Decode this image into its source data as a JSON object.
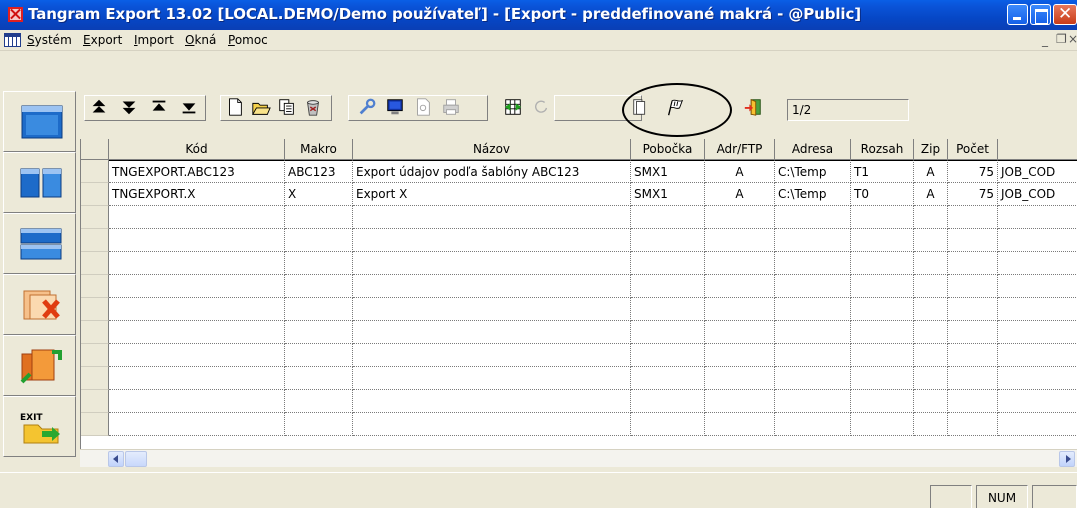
{
  "window": {
    "title": "Tangram Export 13.02 [LOCAL.DEMO/Demo používateľ] - [Export - preddefinované makrá - @Public]",
    "close_glyph": "✕"
  },
  "menu": {
    "items": [
      {
        "prefix": "",
        "underline": "S",
        "rest": "ystém"
      },
      {
        "prefix": "",
        "underline": "E",
        "rest": "xport"
      },
      {
        "prefix": "",
        "underline": "I",
        "rest": "mport"
      },
      {
        "prefix": "",
        "underline": "O",
        "rest": "kná"
      },
      {
        "prefix": "",
        "underline": "P",
        "rest": "omoc"
      }
    ],
    "mdi_min": "_",
    "mdi_restore": "❐",
    "mdi_close": "×"
  },
  "toolbar": {
    "page_indicator": "1/2"
  },
  "grid": {
    "columns": [
      "Kód",
      "Makro",
      "Názov",
      "Pobočka",
      "Adr/FTP",
      "Adresa",
      "Rozsah",
      "Zip",
      "Počet",
      ""
    ],
    "rows": [
      [
        "TNGEXPORT.ABC123",
        "ABC123",
        "Export údajov podľa šablóny ABC123",
        "SMX1",
        "A",
        "C:\\Temp",
        "T1",
        "A",
        "75",
        "JOB_COD"
      ],
      [
        "TNGEXPORT.X",
        "X",
        "Export X",
        "SMX1",
        "A",
        "C:\\Temp",
        "T0",
        "A",
        "75",
        "JOB_COD"
      ]
    ]
  },
  "status": {
    "panel0": "",
    "num": "NUM",
    "panel2": ""
  },
  "colors": {
    "titlebar": "#0a54d9",
    "chrome": "#ece9d8",
    "close_button": "#c83c18"
  },
  "icons": {
    "sidebar": [
      "window-icon",
      "tile-windows-icon",
      "cascade-windows-icon",
      "delete-document-icon",
      "copy-documents-icon",
      "exit-icon"
    ],
    "toolbar": [
      "sort-up-icon",
      "sort-down-icon",
      "first-record-icon",
      "last-record-icon",
      "new-document-icon",
      "open-folder-icon",
      "copy-icon",
      "recycle-bin-icon",
      "wrench-icon",
      "monitor-icon",
      "print-preview-icon",
      "printer-icon",
      "grid-export-icon",
      "refresh-icon",
      "document-icon",
      "flag-icon",
      "exit-door-icon"
    ]
  }
}
